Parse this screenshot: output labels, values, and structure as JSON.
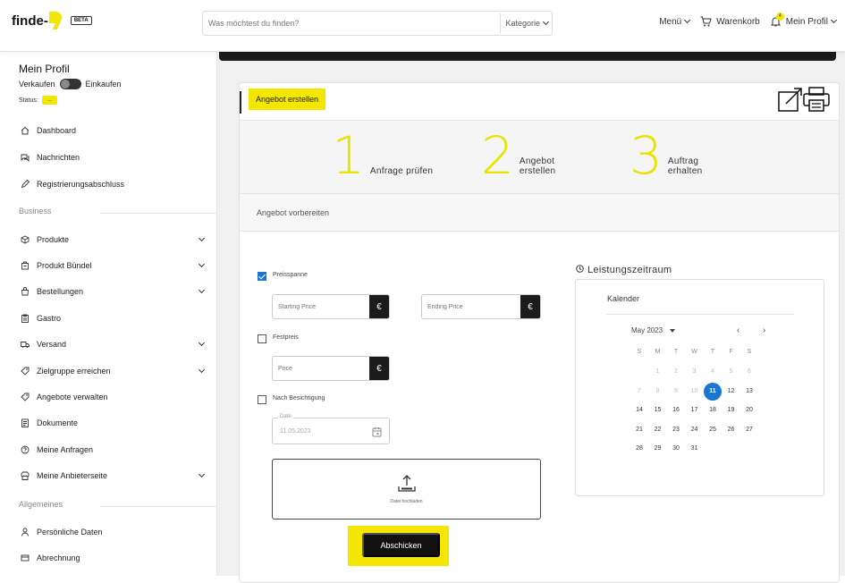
{
  "topbar": {
    "logo": "finde-",
    "beta": "BETA",
    "search_placeholder": "Was möchtest du finden?",
    "category": "Kategorie",
    "menu": "Menü",
    "cart": "Warenkorb",
    "notification_count": "4",
    "profile": "Mein Profil"
  },
  "sidebar": {
    "title": "Mein Profil",
    "toggle_left": "Verkaufen",
    "toggle_right": "Einkaufen",
    "status_label": "Status:",
    "status_value": "...",
    "items": [
      {
        "label": "Dashboard",
        "icon": "home-icon"
      },
      {
        "label": "Nachrichten",
        "icon": "chat-icon"
      },
      {
        "label": "Registrierungsabschluss",
        "icon": "pen-icon"
      }
    ],
    "business_label": "Business",
    "business_items": [
      {
        "label": "Produkte",
        "icon": "box-icon"
      },
      {
        "label": "Produkt Bündel",
        "icon": "bundle-icon"
      },
      {
        "label": "Bestellungen",
        "icon": "bag-icon"
      },
      {
        "label": "Gastro",
        "icon": "clipboard-icon"
      },
      {
        "label": "Versand",
        "icon": "truck-icon"
      },
      {
        "label": "Zielgruppe erreichen",
        "icon": "target-icon"
      },
      {
        "label": "Angebote verwalten",
        "icon": "tag-icon"
      },
      {
        "label": "Dokumente",
        "icon": "document-icon"
      },
      {
        "label": "Meine Anfragen",
        "icon": "question-icon"
      },
      {
        "label": "Meine Anbieterseite",
        "icon": "store-icon"
      }
    ],
    "general_label": "Allgemeines",
    "general_items": [
      {
        "label": "Persönliche Daten",
        "icon": "person-icon"
      },
      {
        "label": "Abrechnung",
        "icon": "billing-icon"
      }
    ]
  },
  "card": {
    "title": "Angebot erstellen",
    "steps": [
      {
        "num": "1",
        "label": "Anfrage prüfen"
      },
      {
        "num": "2",
        "label_line1": "Angebot",
        "label_line2": "erstellen"
      },
      {
        "num": "3",
        "label_line1": "Auftrag",
        "label_line2": "erhalten"
      }
    ],
    "prep_label": "Angebot vorbereiten",
    "preisspanne": "Preisspanne",
    "starting_price_placeholder": "Starting Price",
    "ending_price_placeholder": "Ending Price",
    "currency": "€",
    "festpreis": "Festpreis",
    "price_placeholder": "Price",
    "nach_besichtigung": "Nach Besichtigung",
    "date_legend": "Date",
    "date_value": "11.05.2023",
    "upload_label": "Datei hochladen",
    "submit": "Abschicken"
  },
  "calendar": {
    "title": "Leistungszeitraum",
    "header": "Kalender",
    "month": "May 2023",
    "prev": "‹",
    "next": "›",
    "weekdays": [
      "S",
      "M",
      "T",
      "W",
      "T",
      "F",
      "S"
    ],
    "weeks": [
      [
        "",
        "1",
        "2",
        "3",
        "4",
        "5",
        "6"
      ],
      [
        "7",
        "8",
        "9",
        "10",
        "11",
        "12",
        "13"
      ],
      [
        "14",
        "15",
        "16",
        "17",
        "18",
        "19",
        "20"
      ],
      [
        "21",
        "22",
        "23",
        "24",
        "25",
        "26",
        "27"
      ],
      [
        "28",
        "29",
        "30",
        "31",
        "",
        "",
        ""
      ]
    ],
    "selected": "11"
  }
}
